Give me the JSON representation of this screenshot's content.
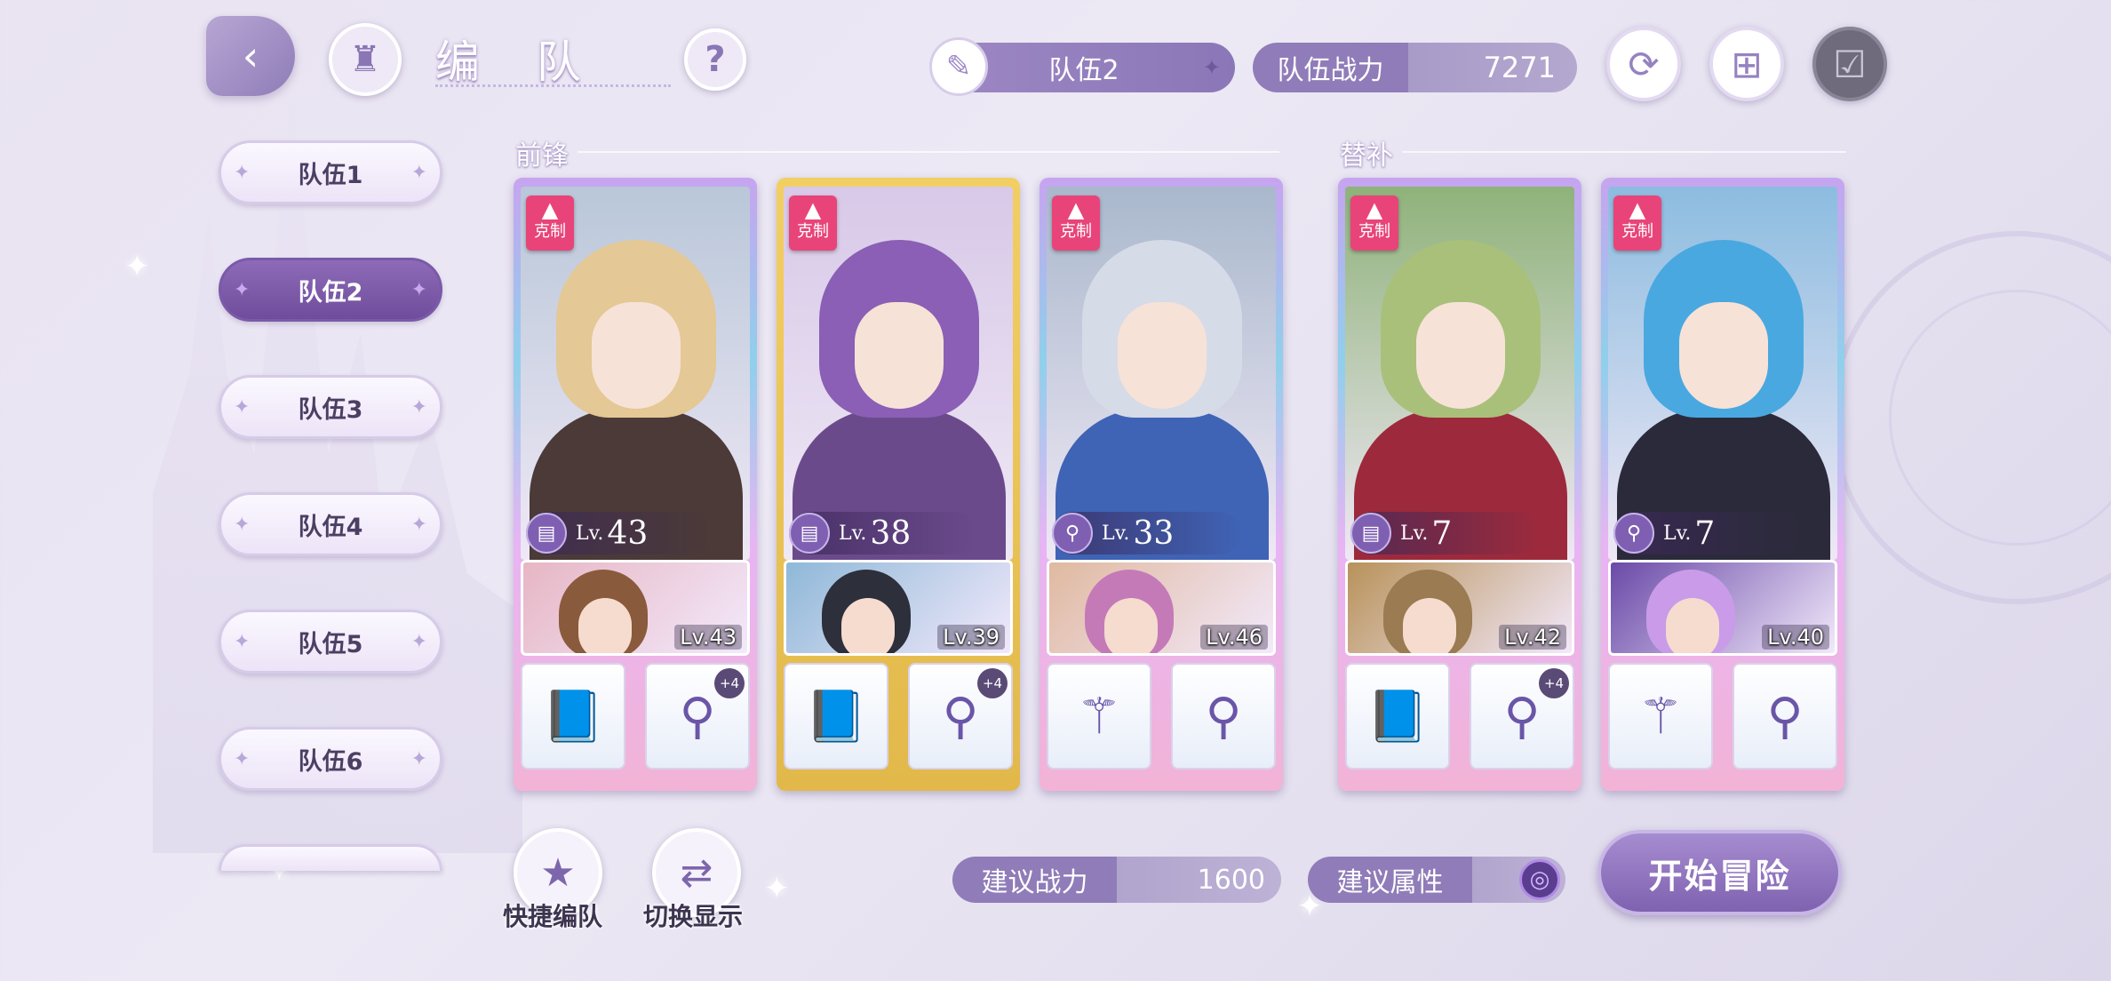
{
  "header": {
    "title": "编 队",
    "help_icon": "question-icon",
    "back_icon": "back-arrow-icon",
    "home_icon": "castle-icon"
  },
  "team_select": {
    "label": "队伍2",
    "icon": "feather-icon"
  },
  "team_power": {
    "label": "队伍战力",
    "value": "7271"
  },
  "top_actions": [
    {
      "name": "refresh-button",
      "icon": "refresh-icon"
    },
    {
      "name": "copy-button",
      "icon": "copy-plus-icon"
    },
    {
      "name": "confirm-button",
      "icon": "check-icon"
    }
  ],
  "teams": [
    {
      "label": "队伍1",
      "active": false
    },
    {
      "label": "队伍2",
      "active": true
    },
    {
      "label": "队伍3",
      "active": false
    },
    {
      "label": "队伍4",
      "active": false
    },
    {
      "label": "队伍5",
      "active": false
    },
    {
      "label": "队伍6",
      "active": false
    }
  ],
  "sections": {
    "front": "前锋",
    "sub": "替补"
  },
  "badge_label": "克制",
  "lv_prefix": "Lv.",
  "cards": [
    {
      "level": "43",
      "hair": "#e4c895",
      "body": "#4b3a37",
      "bg": "#b9c7d9",
      "class_icon": "book-icon",
      "sub_level": "Lv.43",
      "sub_hair": "#8a5a3c",
      "sub_bg": "#e7b6c4",
      "gold": false,
      "equip": [
        {
          "icon": "book",
          "plus": ""
        },
        {
          "icon": "earring",
          "plus": "+4"
        }
      ]
    },
    {
      "level": "38",
      "hair": "#8a5fb5",
      "body": "#6b4a8c",
      "bg": "#d8c9e8",
      "class_icon": "book-icon",
      "sub_level": "Lv.39",
      "sub_hair": "#2d2f3a",
      "sub_bg": "#8fb8d8",
      "gold": true,
      "equip": [
        {
          "icon": "book",
          "plus": ""
        },
        {
          "icon": "earring",
          "plus": "+4"
        }
      ]
    },
    {
      "level": "33",
      "hair": "#d6dbe8",
      "body": "#3f63b5",
      "bg": "#a9b8cc",
      "class_icon": "wand-icon",
      "sub_level": "Lv.46",
      "sub_hair": "#c57ab8",
      "sub_bg": "#e0b9a0",
      "gold": false,
      "equip": [
        {
          "icon": "wand",
          "plus": ""
        },
        {
          "icon": "earring",
          "plus": ""
        }
      ]
    },
    {
      "level": "7",
      "hair": "#a9c07a",
      "body": "#9c2a3c",
      "bg": "#8fb27a",
      "class_icon": "book-icon",
      "sub_level": "Lv.42",
      "sub_hair": "#9a7b52",
      "sub_bg": "#b8925a",
      "gold": false,
      "equip": [
        {
          "icon": "book",
          "plus": ""
        },
        {
          "icon": "earring",
          "plus": "+4"
        }
      ]
    },
    {
      "level": "7",
      "hair": "#4aa8e0",
      "body": "#2b2a3a",
      "bg": "#8cbce0",
      "class_icon": "wand-icon",
      "sub_level": "Lv.40",
      "sub_hair": "#c99be8",
      "sub_bg": "#6a4aa8",
      "gold": false,
      "equip": [
        {
          "icon": "wand",
          "plus": ""
        },
        {
          "icon": "earring",
          "plus": ""
        }
      ]
    }
  ],
  "bottom": {
    "quick_team": "快捷编队",
    "switch_display": "切换显示",
    "suggest_power_label": "建议战力",
    "suggest_power_value": "1600",
    "suggest_attr_label": "建议属性",
    "start": "开始冒险"
  }
}
